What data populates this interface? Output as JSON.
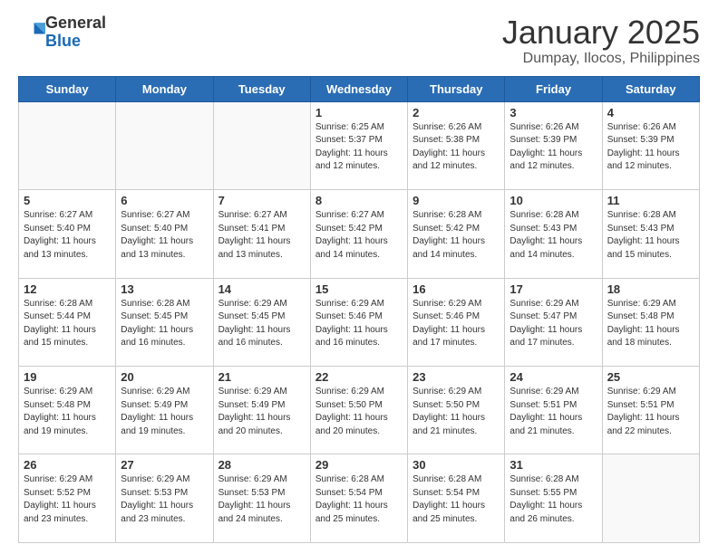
{
  "logo": {
    "general": "General",
    "blue": "Blue"
  },
  "header": {
    "month": "January 2025",
    "location": "Dumpay, Ilocos, Philippines"
  },
  "days_of_week": [
    "Sunday",
    "Monday",
    "Tuesday",
    "Wednesday",
    "Thursday",
    "Friday",
    "Saturday"
  ],
  "weeks": [
    [
      {
        "day": "",
        "sunrise": "",
        "sunset": "",
        "daylight": "",
        "empty": true
      },
      {
        "day": "",
        "sunrise": "",
        "sunset": "",
        "daylight": "",
        "empty": true
      },
      {
        "day": "",
        "sunrise": "",
        "sunset": "",
        "daylight": "",
        "empty": true
      },
      {
        "day": "1",
        "sunrise": "6:25 AM",
        "sunset": "5:37 PM",
        "daylight": "11 hours and 12 minutes."
      },
      {
        "day": "2",
        "sunrise": "6:26 AM",
        "sunset": "5:38 PM",
        "daylight": "11 hours and 12 minutes."
      },
      {
        "day": "3",
        "sunrise": "6:26 AM",
        "sunset": "5:39 PM",
        "daylight": "11 hours and 12 minutes."
      },
      {
        "day": "4",
        "sunrise": "6:26 AM",
        "sunset": "5:39 PM",
        "daylight": "11 hours and 12 minutes."
      }
    ],
    [
      {
        "day": "5",
        "sunrise": "6:27 AM",
        "sunset": "5:40 PM",
        "daylight": "11 hours and 13 minutes."
      },
      {
        "day": "6",
        "sunrise": "6:27 AM",
        "sunset": "5:40 PM",
        "daylight": "11 hours and 13 minutes."
      },
      {
        "day": "7",
        "sunrise": "6:27 AM",
        "sunset": "5:41 PM",
        "daylight": "11 hours and 13 minutes."
      },
      {
        "day": "8",
        "sunrise": "6:27 AM",
        "sunset": "5:42 PM",
        "daylight": "11 hours and 14 minutes."
      },
      {
        "day": "9",
        "sunrise": "6:28 AM",
        "sunset": "5:42 PM",
        "daylight": "11 hours and 14 minutes."
      },
      {
        "day": "10",
        "sunrise": "6:28 AM",
        "sunset": "5:43 PM",
        "daylight": "11 hours and 14 minutes."
      },
      {
        "day": "11",
        "sunrise": "6:28 AM",
        "sunset": "5:43 PM",
        "daylight": "11 hours and 15 minutes."
      }
    ],
    [
      {
        "day": "12",
        "sunrise": "6:28 AM",
        "sunset": "5:44 PM",
        "daylight": "11 hours and 15 minutes."
      },
      {
        "day": "13",
        "sunrise": "6:28 AM",
        "sunset": "5:45 PM",
        "daylight": "11 hours and 16 minutes."
      },
      {
        "day": "14",
        "sunrise": "6:29 AM",
        "sunset": "5:45 PM",
        "daylight": "11 hours and 16 minutes."
      },
      {
        "day": "15",
        "sunrise": "6:29 AM",
        "sunset": "5:46 PM",
        "daylight": "11 hours and 16 minutes."
      },
      {
        "day": "16",
        "sunrise": "6:29 AM",
        "sunset": "5:46 PM",
        "daylight": "11 hours and 17 minutes."
      },
      {
        "day": "17",
        "sunrise": "6:29 AM",
        "sunset": "5:47 PM",
        "daylight": "11 hours and 17 minutes."
      },
      {
        "day": "18",
        "sunrise": "6:29 AM",
        "sunset": "5:48 PM",
        "daylight": "11 hours and 18 minutes."
      }
    ],
    [
      {
        "day": "19",
        "sunrise": "6:29 AM",
        "sunset": "5:48 PM",
        "daylight": "11 hours and 19 minutes."
      },
      {
        "day": "20",
        "sunrise": "6:29 AM",
        "sunset": "5:49 PM",
        "daylight": "11 hours and 19 minutes."
      },
      {
        "day": "21",
        "sunrise": "6:29 AM",
        "sunset": "5:49 PM",
        "daylight": "11 hours and 20 minutes."
      },
      {
        "day": "22",
        "sunrise": "6:29 AM",
        "sunset": "5:50 PM",
        "daylight": "11 hours and 20 minutes."
      },
      {
        "day": "23",
        "sunrise": "6:29 AM",
        "sunset": "5:50 PM",
        "daylight": "11 hours and 21 minutes."
      },
      {
        "day": "24",
        "sunrise": "6:29 AM",
        "sunset": "5:51 PM",
        "daylight": "11 hours and 21 minutes."
      },
      {
        "day": "25",
        "sunrise": "6:29 AM",
        "sunset": "5:51 PM",
        "daylight": "11 hours and 22 minutes."
      }
    ],
    [
      {
        "day": "26",
        "sunrise": "6:29 AM",
        "sunset": "5:52 PM",
        "daylight": "11 hours and 23 minutes."
      },
      {
        "day": "27",
        "sunrise": "6:29 AM",
        "sunset": "5:53 PM",
        "daylight": "11 hours and 23 minutes."
      },
      {
        "day": "28",
        "sunrise": "6:29 AM",
        "sunset": "5:53 PM",
        "daylight": "11 hours and 24 minutes."
      },
      {
        "day": "29",
        "sunrise": "6:28 AM",
        "sunset": "5:54 PM",
        "daylight": "11 hours and 25 minutes."
      },
      {
        "day": "30",
        "sunrise": "6:28 AM",
        "sunset": "5:54 PM",
        "daylight": "11 hours and 25 minutes."
      },
      {
        "day": "31",
        "sunrise": "6:28 AM",
        "sunset": "5:55 PM",
        "daylight": "11 hours and 26 minutes."
      },
      {
        "day": "",
        "sunrise": "",
        "sunset": "",
        "daylight": "",
        "empty": true
      }
    ]
  ],
  "labels": {
    "sunrise": "Sunrise:",
    "sunset": "Sunset:",
    "daylight": "Daylight:"
  }
}
